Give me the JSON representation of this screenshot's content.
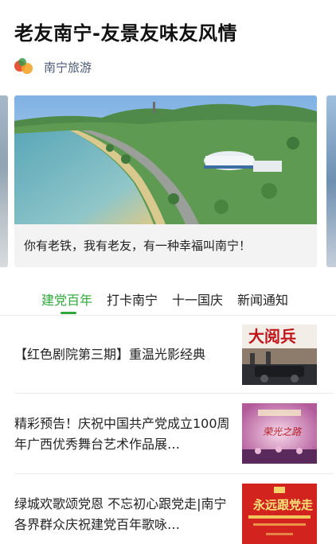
{
  "page": {
    "title": "老友南宁-友景友味友风情",
    "source": {
      "name": "南宁旅游",
      "logo_icon": "nanning-tourism-logo-icon"
    }
  },
  "banner": {
    "caption": "你有老铁，我有老友，有一种幸福叫南宁！"
  },
  "tabs": [
    {
      "label": "建党百年",
      "active": true
    },
    {
      "label": "打卡南宁",
      "active": false
    },
    {
      "label": "十一国庆",
      "active": false
    },
    {
      "label": "新闻通知",
      "active": false
    }
  ],
  "articles": [
    {
      "title": "【红色剧院第三期】重温光影经典",
      "thumb_icon": "theater-poster-thumbnail"
    },
    {
      "title": "精彩预告！庆祝中国共产党成立100周年广西优秀舞台艺术作品展…",
      "thumb_icon": "stage-performance-thumbnail"
    },
    {
      "title": "绿城欢歌颂党恩 不忘初心跟党走|南宁各界群众庆祝建党百年歌咏…",
      "thumb_icon": "red-poster-thumbnail"
    }
  ],
  "colors": {
    "accent": "#2fa83b",
    "source_text": "#4a5a78"
  }
}
